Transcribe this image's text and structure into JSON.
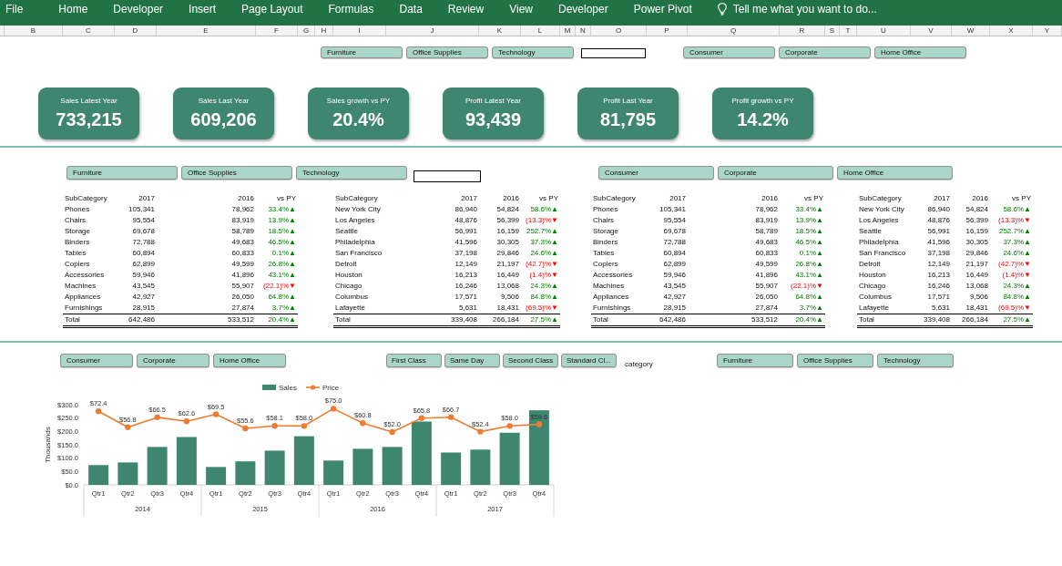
{
  "menu_bar": {
    "tabs": [
      "File",
      "Home",
      "Developer",
      "Insert",
      "Page Layout",
      "Formulas",
      "Data",
      "Review",
      "View",
      "Developer",
      "Power Pivot"
    ],
    "tell_me": "Tell me what you want to do..."
  },
  "column_headers": [
    "B",
    "C",
    "D",
    "E",
    "F",
    "G",
    "H",
    "I",
    "J",
    "K",
    "L",
    "M",
    "N",
    "O",
    "P",
    "Q",
    "R",
    "S",
    "T",
    "U",
    "V",
    "W",
    "X",
    "Y"
  ],
  "header_filters": [
    {
      "items": [
        {
          "label": "Furniture",
          "selected": true
        },
        {
          "label": "Office Supplies",
          "selected": true
        },
        {
          "label": "Technology",
          "selected": true
        }
      ]
    },
    {
      "items": [
        {
          "label": "Consumer",
          "selected": true
        },
        {
          "label": "Corporate",
          "selected": true
        },
        {
          "label": "Home Office",
          "selected": true
        }
      ]
    }
  ],
  "kpis": [
    {
      "label": "Sales Latest Year",
      "value": "733,215"
    },
    {
      "label": "Sales Last Year",
      "value": "609,206"
    },
    {
      "label": "Sales growth vs PY",
      "value": "20.4%"
    },
    {
      "label": "Profit Latest Year",
      "value": "93,439"
    },
    {
      "label": "Profit Last Year",
      "value": "81,795"
    },
    {
      "label": "Profit growth vs PY",
      "value": "14.2%"
    }
  ],
  "table_filters": [
    {
      "items": [
        {
          "label": "Furniture",
          "selected": true
        },
        {
          "label": "Office Supplies",
          "selected": true
        },
        {
          "label": "Technology",
          "selected": true
        }
      ]
    },
    {
      "items": [
        {
          "label": "Consumer",
          "selected": true
        },
        {
          "label": "Corporate",
          "selected": true
        },
        {
          "label": "Home Office",
          "selected": true
        }
      ]
    }
  ],
  "tables": [
    {
      "columns": [
        "SubCategory",
        "2017",
        "2016",
        "vs PY"
      ],
      "rows": [
        {
          "cells": [
            "Phones",
            "105,341",
            "78,962",
            "33.4%▲"
          ],
          "color": "#008000"
        },
        {
          "cells": [
            "Chairs",
            "95,554",
            "83,919",
            "13.9%▲"
          ],
          "color": "#008000"
        },
        {
          "cells": [
            "Storage",
            "69,678",
            "58,789",
            "18.5%▲"
          ],
          "color": "#008000"
        },
        {
          "cells": [
            "Binders",
            "72,788",
            "49,683",
            "46.5%▲"
          ],
          "color": "#008000"
        },
        {
          "cells": [
            "Tables",
            "60,894",
            "60,833",
            "0.1%▲"
          ],
          "color": "#008000"
        },
        {
          "cells": [
            "Copiers",
            "62,899",
            "49,599",
            "26.8%▲"
          ],
          "color": "#008000"
        },
        {
          "cells": [
            "Accessories",
            "59,946",
            "41,896",
            "43.1%▲"
          ],
          "color": "#008000"
        },
        {
          "cells": [
            "Machines",
            "43,545",
            "55,907",
            "(22.1)%▼"
          ],
          "color": "#ff0000"
        },
        {
          "cells": [
            "Appliances",
            "42,927",
            "26,050",
            "64.8%▲"
          ],
          "color": "#008000"
        },
        {
          "cells": [
            "Furnishings",
            "28,915",
            "27,874",
            "3.7%▲"
          ],
          "color": "#008000"
        }
      ],
      "total": {
        "cells": [
          "Total",
          "642,486",
          "533,512",
          "20.4%▲"
        ],
        "color": "#008000"
      }
    },
    {
      "columns": [
        "SubCategory",
        "2017",
        "2016",
        "vs PY"
      ],
      "rows": [
        {
          "cells": [
            "New York City",
            "86,940",
            "54,824",
            "58.6%▲"
          ],
          "color": "#008000"
        },
        {
          "cells": [
            "Los Angeles",
            "48,876",
            "56,399",
            "(13.3)%▼"
          ],
          "color": "#ff0000"
        },
        {
          "cells": [
            "Seattle",
            "56,991",
            "16,159",
            "252.7%▲"
          ],
          "color": "#008000"
        },
        {
          "cells": [
            "Philadelphia",
            "41,596",
            "30,305",
            "37.3%▲"
          ],
          "color": "#008000"
        },
        {
          "cells": [
            "San Francisco",
            "37,198",
            "29,846",
            "24.6%▲"
          ],
          "color": "#008000"
        },
        {
          "cells": [
            "Detroit",
            "12,149",
            "21,197",
            "(42.7)%▼"
          ],
          "color": "#ff0000"
        },
        {
          "cells": [
            "Houston",
            "16,213",
            "16,449",
            "(1.4)%▼"
          ],
          "color": "#ff0000"
        },
        {
          "cells": [
            "Chicago",
            "16,246",
            "13,068",
            "24.3%▲"
          ],
          "color": "#008000"
        },
        {
          "cells": [
            "Columbus",
            "17,571",
            "9,506",
            "84.8%▲"
          ],
          "color": "#008000"
        },
        {
          "cells": [
            "Lafayette",
            "5,631",
            "18,431",
            "(69.5)%▼"
          ],
          "color": "#ff0000"
        }
      ],
      "total": {
        "cells": [
          "Total",
          "339,408",
          "266,184",
          "27.5%▲"
        ],
        "color": "#008000"
      }
    },
    {
      "columns": [
        "SubCategory",
        "2017",
        "2016",
        "vs PY"
      ],
      "rows": [
        {
          "cells": [
            "Phones",
            "105,341",
            "78,962",
            "33.4%▲"
          ],
          "color": "#008000"
        },
        {
          "cells": [
            "Chairs",
            "95,554",
            "83,919",
            "13.9%▲"
          ],
          "color": "#008000"
        },
        {
          "cells": [
            "Storage",
            "69,678",
            "58,789",
            "18.5%▲"
          ],
          "color": "#008000"
        },
        {
          "cells": [
            "Binders",
            "72,788",
            "49,683",
            "46.5%▲"
          ],
          "color": "#008000"
        },
        {
          "cells": [
            "Tables",
            "60,894",
            "60,833",
            "0.1%▲"
          ],
          "color": "#008000"
        },
        {
          "cells": [
            "Copiers",
            "62,899",
            "49,599",
            "26.8%▲"
          ],
          "color": "#008000"
        },
        {
          "cells": [
            "Accessories",
            "59,946",
            "41,896",
            "43.1%▲"
          ],
          "color": "#008000"
        },
        {
          "cells": [
            "Machines",
            "43,545",
            "55,907",
            "(22.1)%▼"
          ],
          "color": "#ff0000"
        },
        {
          "cells": [
            "Appliances",
            "42,927",
            "26,050",
            "64.8%▲"
          ],
          "color": "#008000"
        },
        {
          "cells": [
            "Furnishings",
            "28,915",
            "27,874",
            "3.7%▲"
          ],
          "color": "#008000"
        }
      ],
      "total": {
        "cells": [
          "Total",
          "642,486",
          "533,512",
          "20.4%▲"
        ],
        "color": "#008000"
      }
    },
    {
      "columns": [
        "SubCategory",
        "2017",
        "2016",
        "vs PY"
      ],
      "rows": [
        {
          "cells": [
            "New York City",
            "86,940",
            "54,824",
            "58.6%▲"
          ],
          "color": "#008000"
        },
        {
          "cells": [
            "Los Angeles",
            "48,876",
            "56,399",
            "(13.3)%▼"
          ],
          "color": "#ff0000"
        },
        {
          "cells": [
            "Seattle",
            "56,991",
            "16,159",
            "252.7%▲"
          ],
          "color": "#008000"
        },
        {
          "cells": [
            "Philadelphia",
            "41,596",
            "30,305",
            "37.3%▲"
          ],
          "color": "#008000"
        },
        {
          "cells": [
            "San Francisco",
            "37,198",
            "29,846",
            "24.6%▲"
          ],
          "color": "#008000"
        },
        {
          "cells": [
            "Detroit",
            "12,149",
            "21,197",
            "(42.7)%▼"
          ],
          "color": "#ff0000"
        },
        {
          "cells": [
            "Houston",
            "16,213",
            "16,449",
            "(1.4)%▼"
          ],
          "color": "#ff0000"
        },
        {
          "cells": [
            "Chicago",
            "16,246",
            "13,068",
            "24.3%▲"
          ],
          "color": "#008000"
        },
        {
          "cells": [
            "Columbus",
            "17,571",
            "9,506",
            "84.8%▲"
          ],
          "color": "#008000"
        },
        {
          "cells": [
            "Lafayette",
            "5,631",
            "18,431",
            "(69.5)%▼"
          ],
          "color": "#ff0000"
        }
      ],
      "total": {
        "cells": [
          "Total",
          "339,408",
          "266,184",
          "27.5%▲"
        ],
        "color": "#008000"
      }
    }
  ],
  "chart_filters": {
    "groups": [
      {
        "items": [
          {
            "label": "Consumer",
            "selected": true
          },
          {
            "label": "Corporate",
            "selected": true
          },
          {
            "label": "Home Office",
            "selected": true
          }
        ]
      },
      {
        "items": [
          {
            "label": "First Class",
            "selected": true
          },
          {
            "label": "Same Day",
            "selected": true
          },
          {
            "label": "Second Class",
            "selected": true
          },
          {
            "label": "Standard Cl...",
            "selected": true
          }
        ]
      },
      {
        "items": [
          {
            "label": "Furniture",
            "selected": true
          },
          {
            "label": "Office Supplies",
            "selected": true
          },
          {
            "label": "Technology",
            "selected": true
          }
        ]
      }
    ],
    "note": "category"
  },
  "chart": {
    "chart_data": [
      {
        "type": "bar",
        "ylabel": "Thousands",
        "legend": "top",
        "categories": [
          "Qtr1",
          "Qtr2",
          "Qtr3",
          "Qtr4",
          "Qtr1",
          "Qtr2",
          "Qtr3",
          "Qtr4",
          "Qtr1",
          "Qtr2",
          "Qtr3",
          "Qtr4",
          "Qtr1",
          "Qtr2",
          "Qtr3",
          "Qtr4"
        ],
        "annotations": [
          "2014",
          "2015",
          "2016",
          "2017"
        ],
        "ylim": [
          0,
          300
        ],
        "yticks": [
          {
            "value": 0,
            "label": "$0.0"
          },
          {
            "value": 50,
            "label": "$50.0"
          },
          {
            "value": 100,
            "label": "$100.0"
          },
          {
            "value": 150,
            "label": "$150.0"
          },
          {
            "value": 200,
            "label": "$200.0"
          },
          {
            "value": 250,
            "label": "$250.0"
          },
          {
            "value": 300,
            "label": "$300.0"
          }
        ],
        "series": [
          {
            "name": "Sales",
            "color": "#3f8670",
            "values": [
              74,
              84,
              142,
              179,
              67,
              88,
              128,
              182,
              91,
              135,
              142,
              237,
              121,
              132,
              195,
              279
            ]
          },
          {
            "name": "Price",
            "type": "line",
            "axis": "y2",
            "color": "#ed7d31",
            "marker": "circle",
            "values": [
              72.4,
              56.8,
              66.5,
              62.6,
              69.5,
              55.6,
              58.1,
              58.0,
              75.0,
              60.8,
              52.0,
              65.8,
              66.7,
              52.4,
              58.0,
              59.6
            ],
            "value_labels": [
              "$72.4",
              "$56.8",
              "$66.5",
              "$62.6",
              "$69.5",
              "$55.6",
              "$58.1",
              "$58.0",
              "$75.0",
              "$60.8",
              "$52.0",
              "$65.8",
              "$66.7",
              "$52.4",
              "$58.0",
              "$59.6"
            ]
          }
        ]
      }
    ]
  }
}
